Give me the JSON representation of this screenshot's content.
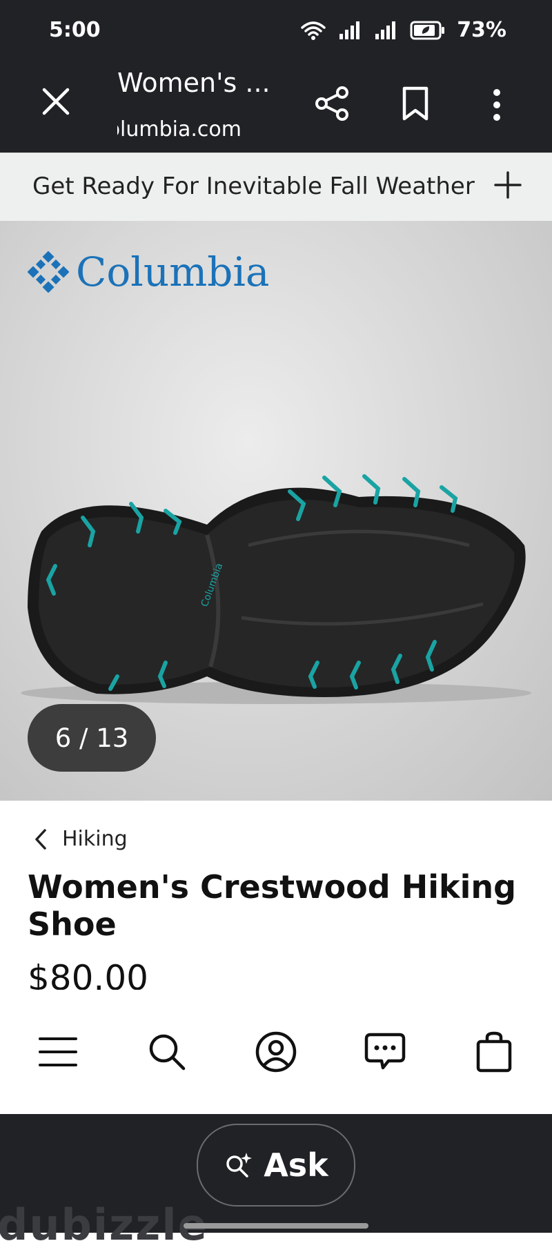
{
  "status_bar": {
    "time": "5:00",
    "battery": "73%"
  },
  "browser": {
    "tab_title": "Women's ...",
    "url": "columbia.com",
    "icons": [
      "close-icon",
      "share-icon",
      "bookmark-icon",
      "more-vert-icon"
    ]
  },
  "promo": {
    "text": "Get Ready For Inevitable Fall Weather",
    "icon": "plus-icon"
  },
  "product_image": {
    "brand": "Columbia",
    "counter": "6 / 13",
    "accent_color": "#1aa3a3",
    "brand_color": "#1b72b8"
  },
  "product": {
    "breadcrumb": "Hiking",
    "title": "Women's Crestwood Hiking Shoe",
    "price": "$80.00"
  },
  "site_nav": {
    "icons": [
      "menu-icon",
      "search-icon",
      "account-icon",
      "chat-icon",
      "bag-icon"
    ]
  },
  "app_footer": {
    "ask_label": "Ask",
    "watermark": "dubizzle",
    "icon": "ask-sparkle-search-icon"
  }
}
